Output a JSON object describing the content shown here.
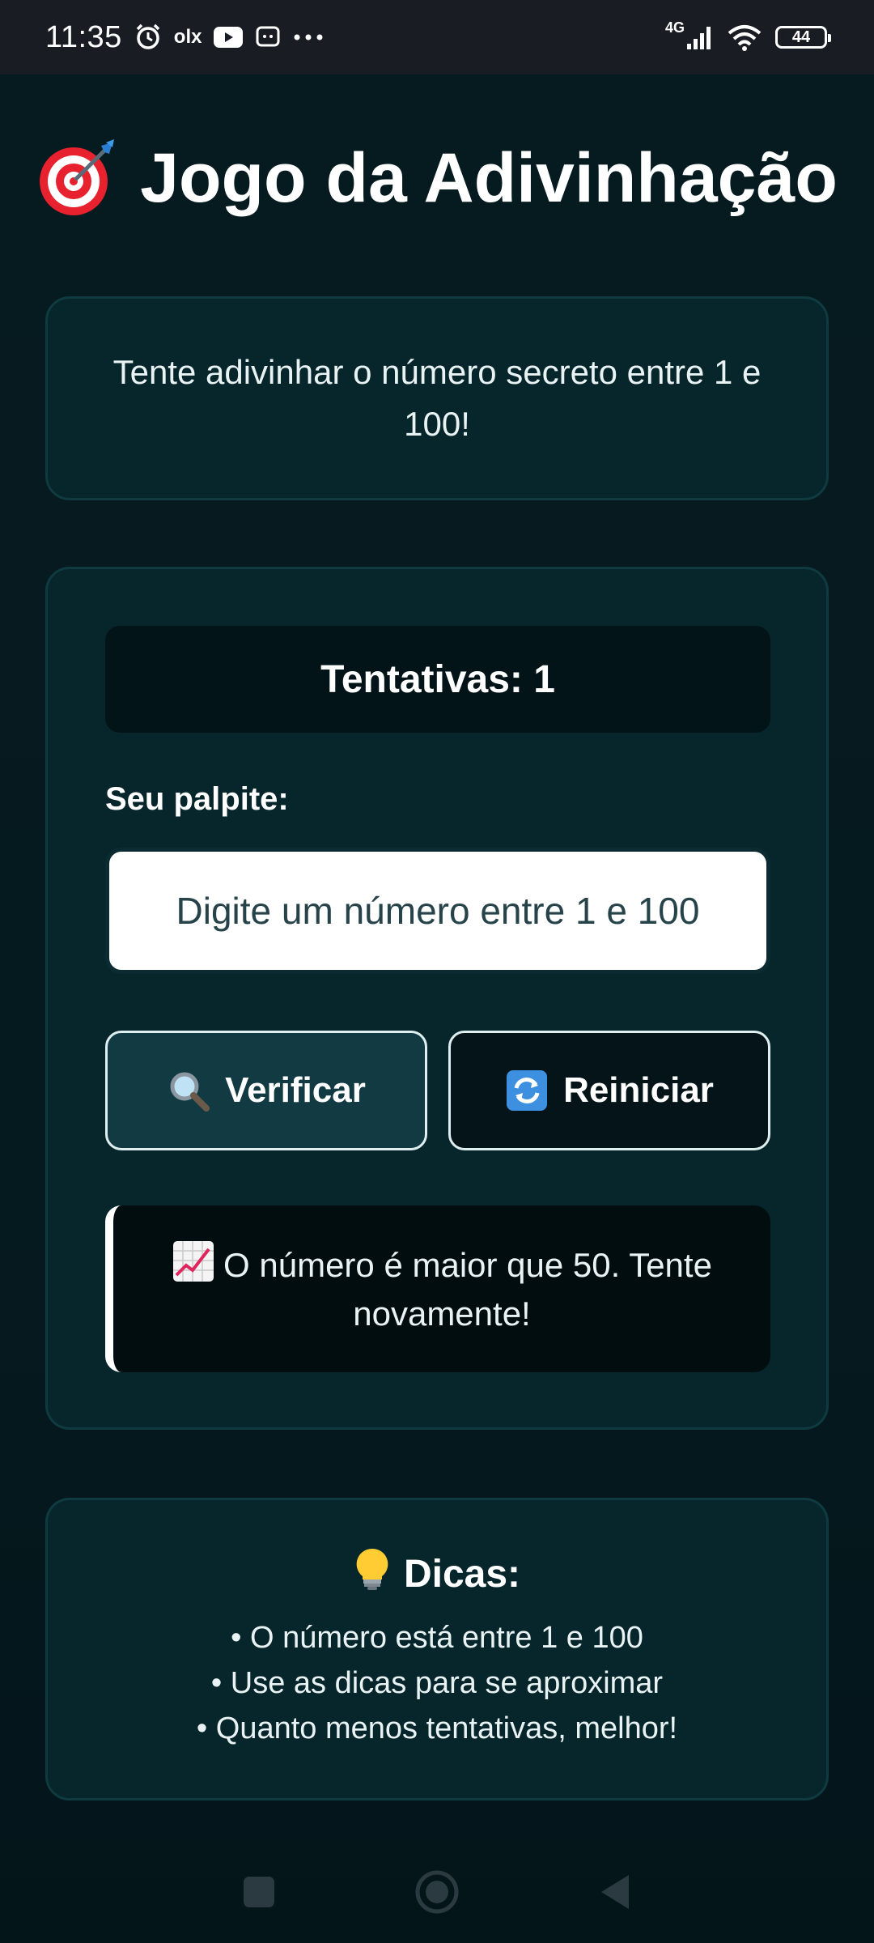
{
  "status_bar": {
    "time": "11:35",
    "network": "4G",
    "battery": "44",
    "icons": [
      "alarm-icon",
      "olx-icon",
      "youtube-icon",
      "notification-icon",
      "more-icon",
      "signal-icon",
      "wifi-icon",
      "battery-icon"
    ],
    "olx_label": "olx"
  },
  "header": {
    "title": "Jogo da Adivinhação",
    "icon": "target-icon"
  },
  "intro": {
    "text": "Tente adivinhar o número secreto entre 1 e 100!"
  },
  "game": {
    "attempts_label": "Tentativas: 1",
    "guess_label": "Seu palpite:",
    "guess_input": {
      "value": "",
      "placeholder": "Digite um número entre 1 e 100"
    },
    "verify_button": {
      "label": "Verificar",
      "icon": "magnifier-icon"
    },
    "reset_button": {
      "label": "Reiniciar",
      "icon": "refresh-icon"
    },
    "feedback": {
      "text": "O número é maior que 50. Tente novamente!",
      "icon": "chart-increasing-icon"
    }
  },
  "tips": {
    "title": "Dicas:",
    "icon": "lightbulb-icon",
    "items": [
      "• O número está entre 1 e 100",
      "• Use as dicas para se aproximar",
      "• Quanto menos tentativas, melhor!"
    ]
  },
  "nav": {
    "buttons": [
      "recents-icon",
      "home-icon",
      "back-icon"
    ]
  },
  "colors": {
    "background": "#05171b",
    "card": "#07262c",
    "card_border": "#0f3a40",
    "verify_button": "#123a42",
    "reset_button": "#041418",
    "feedback_bg": "#020d10"
  }
}
